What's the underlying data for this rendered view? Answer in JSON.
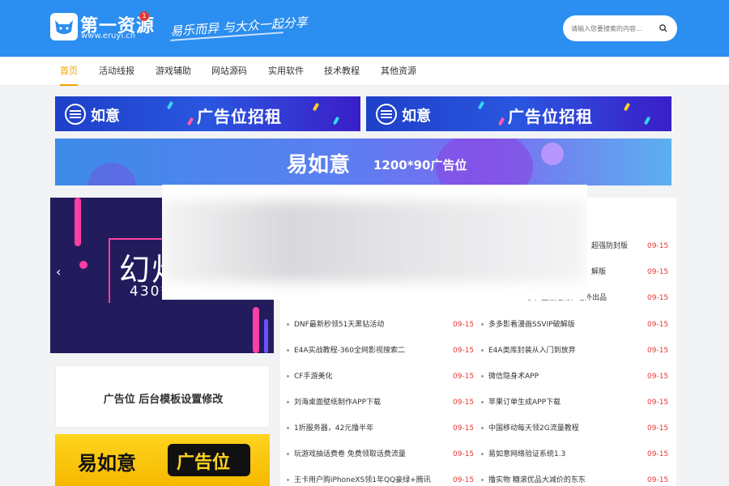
{
  "header": {
    "logo_name": "第一资源",
    "logo_url": "www.eruyi.cn",
    "badge": "1",
    "slogan": "易乐而异 与大众一起分享",
    "search_placeholder": "请输入您要搜索的内容..."
  },
  "nav": [
    "首页",
    "活动线报",
    "游戏辅助",
    "网站源码",
    "实用软件",
    "技术教程",
    "其他资源"
  ],
  "ads": {
    "top_logo": "如意",
    "top_rent": "广告位招租",
    "wide_text": "易如意",
    "wide_size": "1200*90广告位",
    "slider_big": "幻灯",
    "slider_size": "430*300",
    "side_text": "广告位 后台模板设置修改",
    "yellow_left": "易如意",
    "yellow_right": "广告位"
  },
  "colors": {
    "header": "#2b8ef0",
    "nav_active": "#f0a500",
    "date": "#e53935"
  },
  "articles": {
    "right_partial": [
      {
        "title": "超强防封版",
        "date": "09-15"
      },
      {
        "title": "解版",
        "date": "09-15"
      },
      {
        "title": "手，全版通用，老外出品",
        "date": "09-15"
      }
    ],
    "left": [
      {
        "title": "DNF最新秒领51天黑钻活动",
        "date": "09-15"
      },
      {
        "title": "E4A实战教程-360全网影视搜索二",
        "date": "09-15"
      },
      {
        "title": "CF手游美化",
        "date": "09-15"
      },
      {
        "title": "刘海桌面壁纸制作APP下载",
        "date": "09-15"
      },
      {
        "title": "1折服务器，42元撸半年",
        "date": "09-15"
      },
      {
        "title": "玩游戏抽话费卷 免费领取话费流量",
        "date": "09-15"
      },
      {
        "title": "王卡用户购iPhoneXS领1年QQ豪绿+腾讯",
        "date": "09-15"
      }
    ],
    "right": [
      {
        "title": "多多影看漫画SSVIP破解版",
        "date": "09-15"
      },
      {
        "title": "E4A类库封装从入门到放弃",
        "date": "09-15"
      },
      {
        "title": "微信隐身术APP",
        "date": "09-15"
      },
      {
        "title": "苹果订单生成APP下载",
        "date": "09-15"
      },
      {
        "title": "中国移动每天领2G流量教程",
        "date": "09-15"
      },
      {
        "title": "易如意网络验证系统1.3",
        "date": "09-15"
      },
      {
        "title": "撸实物 糖滚优品大减价的东东",
        "date": "09-15"
      }
    ]
  }
}
